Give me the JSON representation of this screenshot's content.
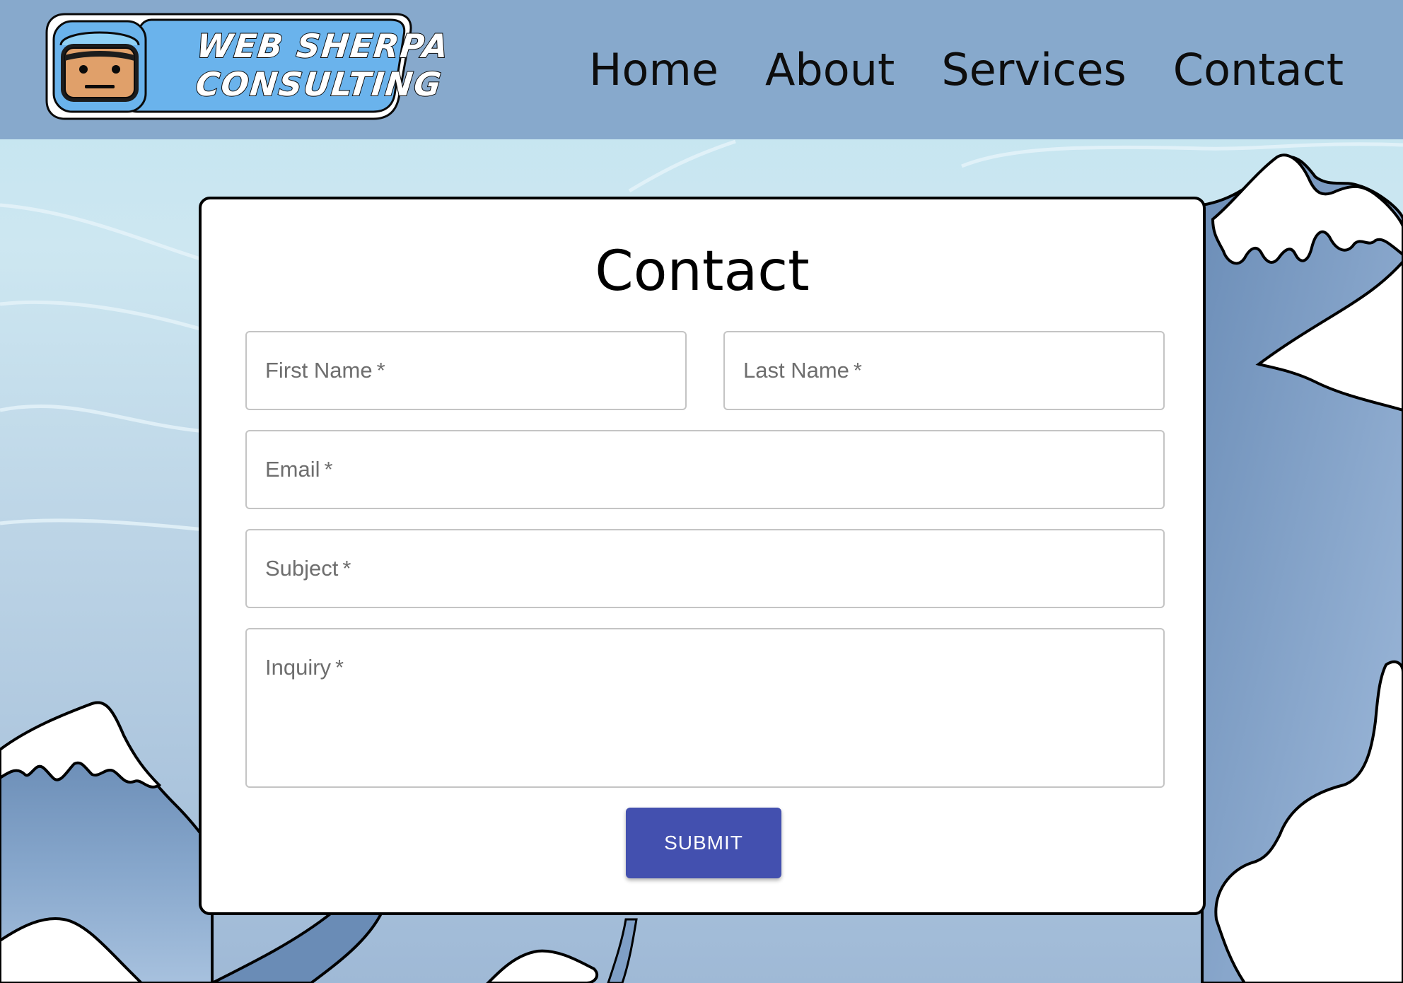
{
  "header": {
    "logo": {
      "line1": "WEB SHERPA",
      "line2": "CONSULTING"
    },
    "nav": [
      {
        "label": "Home"
      },
      {
        "label": "About"
      },
      {
        "label": "Services"
      },
      {
        "label": "Contact"
      }
    ]
  },
  "contact_form": {
    "title": "Contact",
    "fields": {
      "first_name": {
        "placeholder": "First Name",
        "required_mark": "*"
      },
      "last_name": {
        "placeholder": "Last Name",
        "required_mark": "*"
      },
      "email": {
        "placeholder": "Email",
        "required_mark": "*"
      },
      "subject": {
        "placeholder": "Subject",
        "required_mark": "*"
      },
      "inquiry": {
        "placeholder": "Inquiry",
        "required_mark": "*"
      }
    },
    "submit_label": "SUBMIT"
  },
  "colors": {
    "header_bg": "#87a9cc",
    "submit_button": "#4350af",
    "card_border": "#000000",
    "field_border": "#c4c4c4"
  }
}
